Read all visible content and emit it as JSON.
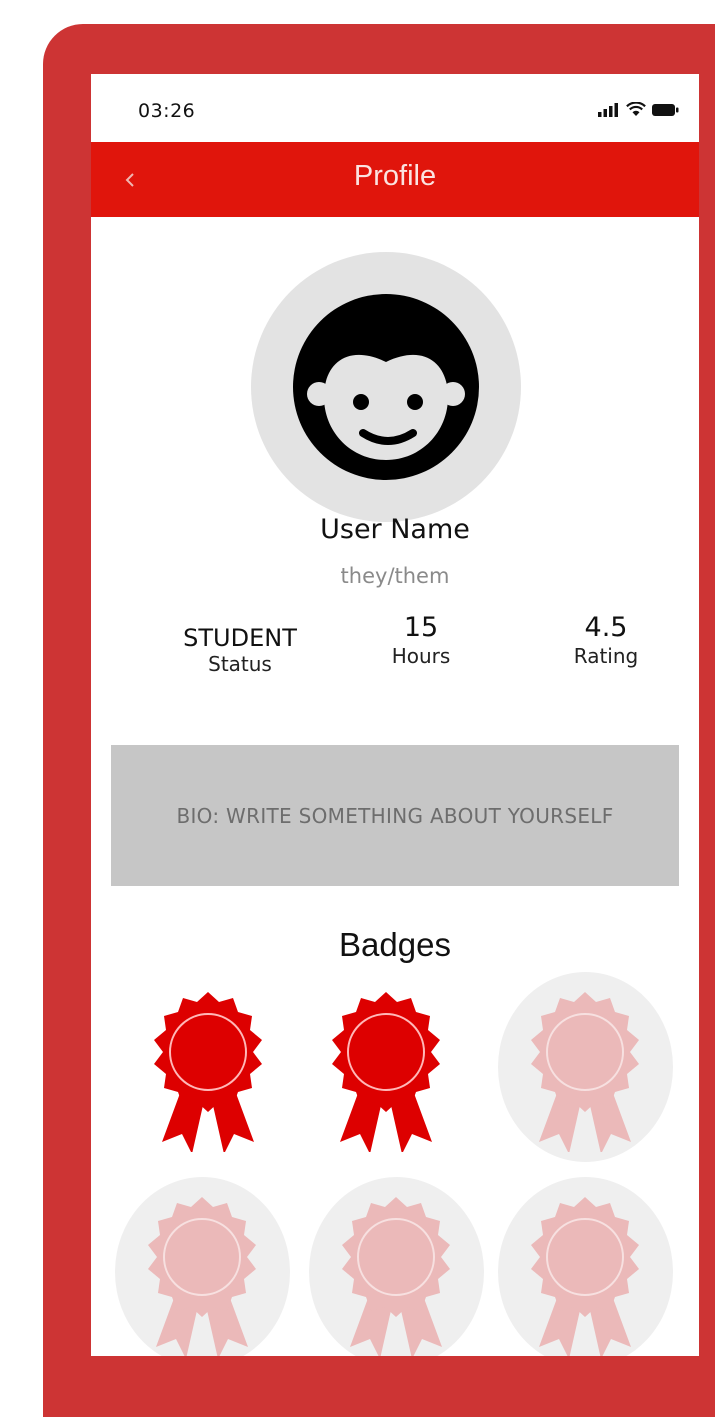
{
  "status_bar": {
    "time": "03:26",
    "icons": [
      "signal-icon",
      "wifi-icon",
      "battery-icon"
    ]
  },
  "header": {
    "back_icon": "chevron-left-icon",
    "title": "Profile"
  },
  "profile": {
    "avatar_icon": "face-icon",
    "name": "User Name",
    "pronouns": "they/them"
  },
  "stats": [
    {
      "value": "STUDENT",
      "label": "Status"
    },
    {
      "value": "15",
      "label": "Hours"
    },
    {
      "value": "4.5",
      "label": "Rating"
    }
  ],
  "bio": {
    "placeholder": "BIO: WRITE SOMETHING ABOUT YOURSELF"
  },
  "badges": {
    "title": "Badges",
    "items": [
      {
        "icon": "ribbon-badge-icon",
        "earned": true
      },
      {
        "icon": "ribbon-badge-icon",
        "earned": true
      },
      {
        "icon": "ribbon-badge-icon",
        "earned": false
      },
      {
        "icon": "ribbon-badge-icon",
        "earned": false
      },
      {
        "icon": "ribbon-badge-icon",
        "earned": false
      },
      {
        "icon": "ribbon-badge-icon",
        "earned": false
      }
    ]
  },
  "colors": {
    "frame": "#cd3434",
    "header": "#e0150c",
    "badge_earned": "#dd0000",
    "badge_locked": "#ebb9b9",
    "bio_background": "#c6c6c6"
  }
}
